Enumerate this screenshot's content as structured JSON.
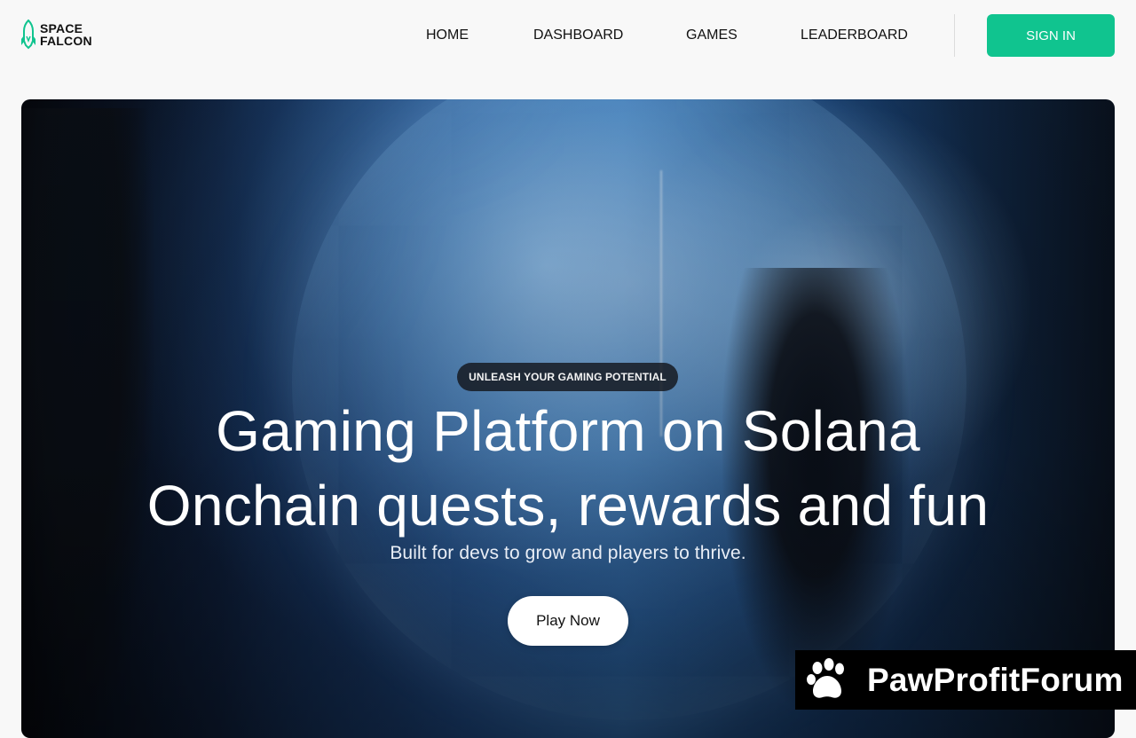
{
  "brand": {
    "line1": "SPACE",
    "line2": "FALCON",
    "accent": "#10c48f"
  },
  "nav": {
    "items": [
      "HOME",
      "DASHBOARD",
      "GAMES",
      "LEADERBOARD"
    ]
  },
  "auth": {
    "signin_label": "SIGN IN"
  },
  "hero": {
    "badge": "UNLEASH YOUR GAMING POTENTIAL",
    "title_line1": "Gaming Platform on Solana",
    "title_line2": "Onchain quests, rewards and fun",
    "subtitle": "Built for devs to grow and players to thrive.",
    "cta": "Play Now"
  },
  "watermark": {
    "text": "PawProfitForum",
    "icon": "paw-icon"
  }
}
